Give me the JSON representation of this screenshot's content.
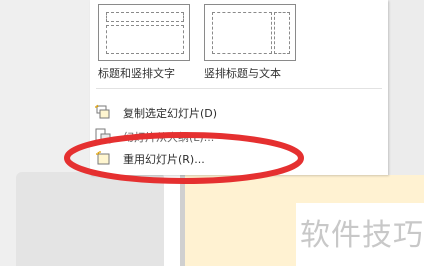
{
  "layouts": [
    {
      "label": "标题和竖排文字"
    },
    {
      "label": "竖排标题与文本"
    }
  ],
  "menu_items": [
    {
      "label": "复制选定幻灯片(D)",
      "icon": "duplicate-slide-icon"
    },
    {
      "label": "幻灯片从大纲(L)...",
      "icon": "slides-from-outline-icon"
    },
    {
      "label": "重用幻灯片(R)...",
      "icon": "reuse-slides-icon"
    }
  ],
  "watermark": "软件技巧",
  "colors": {
    "highlight_ellipse": "#e53030",
    "slide_background": "#fff2d2"
  }
}
